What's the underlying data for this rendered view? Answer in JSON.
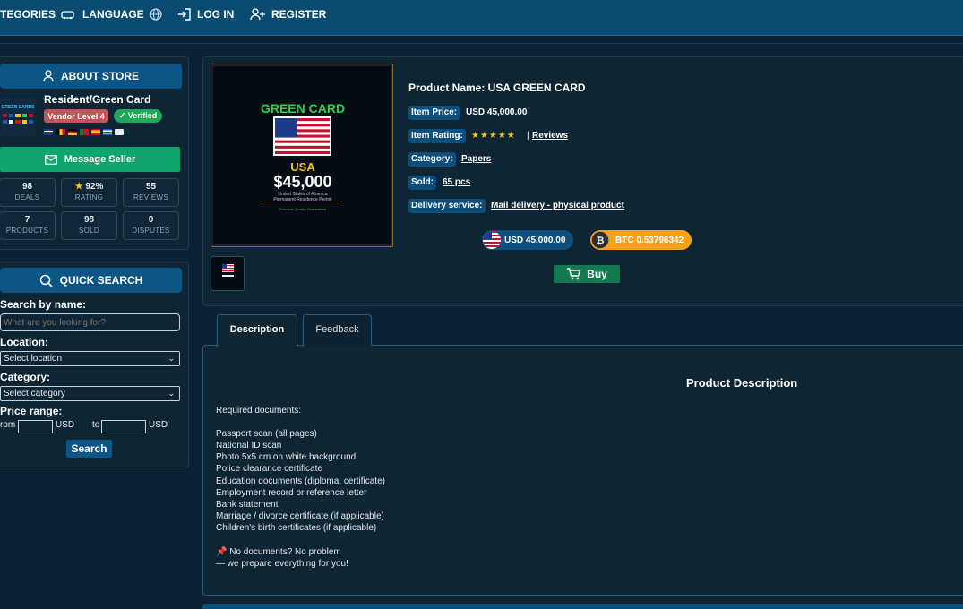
{
  "nav": {
    "categories": "TEGORIES",
    "language": "LANGUAGE",
    "login": "LOG IN",
    "register": "REGISTER"
  },
  "store": {
    "header": "ABOUT STORE",
    "logo_text": "GREEN CARDS",
    "name": "Resident/Green Card",
    "vendor_level": "Vendor Level 4",
    "verified": "✓ Verified",
    "message_button": "Message Seller",
    "stats": [
      {
        "value": "98",
        "label": "DEALS"
      },
      {
        "value": "92%",
        "label": "RATING"
      },
      {
        "value": "55",
        "label": "REVIEWS"
      },
      {
        "value": "7",
        "label": "PRODUCTS"
      },
      {
        "value": "98",
        "label": "SOLD"
      },
      {
        "value": "0",
        "label": "DISPUTES"
      }
    ]
  },
  "quick_search": {
    "header": "QUICK SEARCH",
    "name_label": "Search by name:",
    "name_placeholder": "What are you looking for?",
    "location_label": "Location:",
    "location_value": "Select location",
    "category_label": "Category:",
    "category_value": "Select category",
    "price_label": "Price range:",
    "from": "rom",
    "to": "to",
    "currency": "USD",
    "search_button": "Search"
  },
  "product_image": {
    "title": "GREEN CARD",
    "country": "USA",
    "price": "$45,000",
    "line1": "United States of America",
    "line2": "Permanent Residence Permit",
    "line3": "Premium Quality Guaranteed"
  },
  "product": {
    "name": "Product Name: USA GREEN CARD",
    "price_label": "Item Price:",
    "price_value": "USD 45,000.00",
    "rating_label": "Item Rating:",
    "stars": "★★★★★",
    "reviews_sep": "|",
    "reviews_link": "Reviews",
    "category_label": "Category:",
    "category_value": "Papers",
    "sold_label": "Sold:",
    "sold_value": "65 pcs",
    "delivery_label": "Delivery service:",
    "delivery_value": "Mail delivery - physical product",
    "usd_pill": "USD 45,000.00",
    "btc_pill": "BTC 0.53796342",
    "buy_button": "Buy"
  },
  "tabs": [
    {
      "label": "Description"
    },
    {
      "label": "Feedback"
    }
  ],
  "description": {
    "title": "Product Description",
    "lines": [
      "Required documents:",
      "Passport scan (all pages)",
      "National ID scan",
      "Photo 5x5 cm on white background",
      "Police clearance certificate",
      "Education documents (diploma, certificate)",
      "Employment record or reference letter",
      "Bank statement",
      "Marriage / divorce certificate (if applicable)",
      "Children's birth certificates (if applicable)",
      "📌 No documents? No problem",
      "— we prepare everything for you!"
    ]
  },
  "colors": {
    "nav_bg": "#0a4b72",
    "page_bg": "#0c2131",
    "accent_blue": "#0c5585",
    "green_button": "#10a56c",
    "vendor_badge": "#c0555a",
    "verified_badge": "#1ea85a",
    "btc_orange": "#f7a11a",
    "star_gold": "#f5c518"
  }
}
